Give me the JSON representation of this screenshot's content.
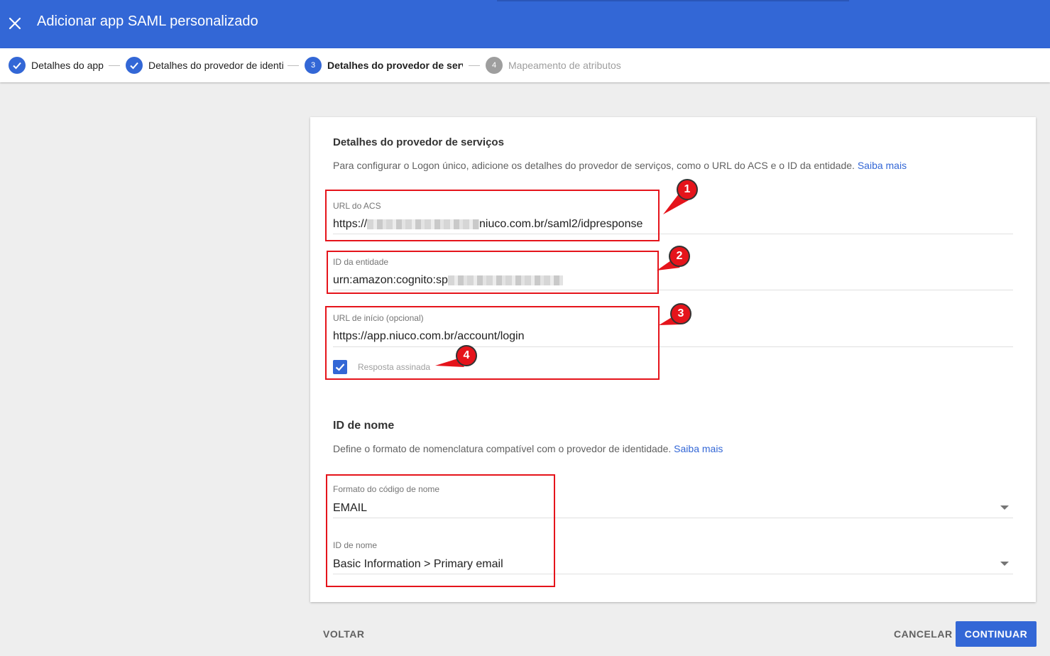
{
  "header": {
    "title": "Adicionar app SAML personalizado",
    "close_icon": "close-icon",
    "color": "#3367d6"
  },
  "stepper": {
    "steps": [
      {
        "label": "Detalhes do app",
        "state": "done"
      },
      {
        "label": "Detalhes do provedor de identidade",
        "state": "done"
      },
      {
        "number": "3",
        "label": "Detalhes do provedor de serviços",
        "state": "active"
      },
      {
        "number": "4",
        "label": "Mapeamento de atributos",
        "state": "pending"
      }
    ]
  },
  "service_provider": {
    "title": "Detalhes do provedor de serviços",
    "description": "Para configurar o Logon único, adicione os detalhes do provedor de serviços, como o URL do ACS e o ID da entidade.",
    "learn_more": "Saiba mais",
    "acs_url": {
      "label": "URL do ACS",
      "value_prefix": "https://",
      "value_suffix": "niuco.com.br/saml2/idpresponse"
    },
    "entity_id": {
      "label": "ID da entidade",
      "value_prefix": "urn:amazon:cognito:sp"
    },
    "start_url": {
      "label": "URL de início (opcional)",
      "value": "https://app.niuco.com.br/account/login"
    },
    "signed_response": {
      "label": "Resposta assinada",
      "checked": true
    }
  },
  "name_id": {
    "title": "ID de nome",
    "description": "Define o formato de nomenclatura compatível com o provedor de identidade.",
    "learn_more": "Saiba mais",
    "format": {
      "label": "Formato do código de nome",
      "value": "EMAIL"
    },
    "name_id_field": {
      "label": "ID de nome",
      "value": "Basic Information > Primary email"
    }
  },
  "annotations": {
    "badges": [
      "1",
      "2",
      "3",
      "4"
    ],
    "color": "#e5141b"
  },
  "footer": {
    "back_label": "VOLTAR",
    "cancel_label": "CANCELAR",
    "continue_label": "CONTINUAR"
  }
}
